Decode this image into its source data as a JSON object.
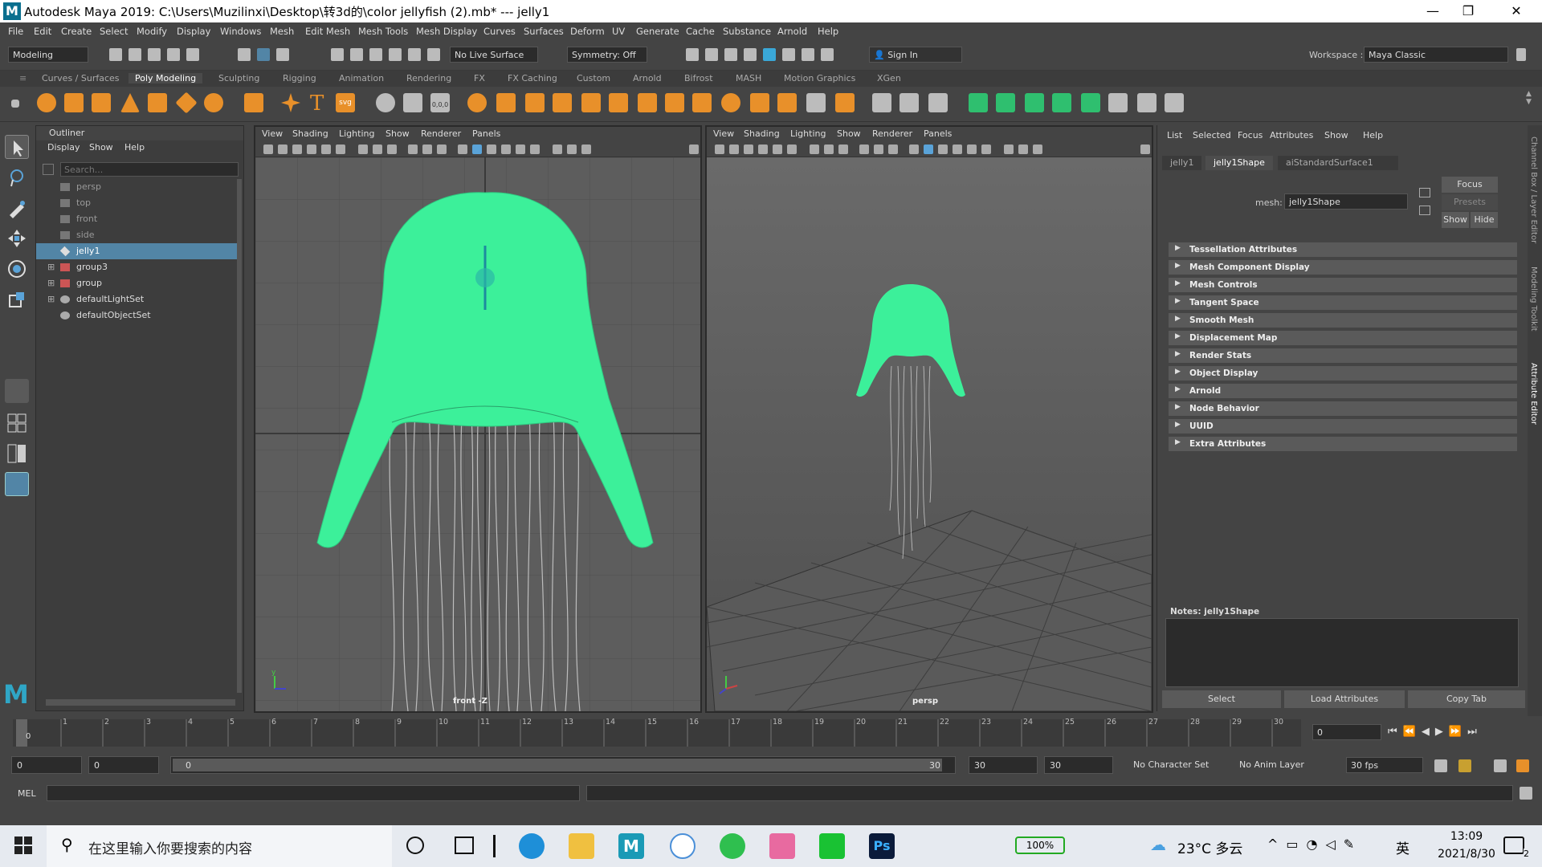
{
  "titlebar": {
    "title": "Autodesk Maya 2019: C:\\Users\\Muzilinxi\\Desktop\\转3d的\\color jellyfish (2).mb*   ---   jelly1",
    "logo": "M"
  },
  "menubar": [
    "File",
    "Edit",
    "Create",
    "Select",
    "Modify",
    "Display",
    "Windows",
    "Mesh",
    "Edit Mesh",
    "Mesh Tools",
    "Mesh Display",
    "Curves",
    "Surfaces",
    "Deform",
    "UV",
    "Generate",
    "Cache",
    "Substance",
    "Arnold",
    "Help"
  ],
  "statusline": {
    "mode": "Modeling",
    "live_surface": "No Live Surface",
    "symmetry": "Symmetry: Off",
    "sign_in": "Sign In",
    "workspace_label": "Workspace :",
    "workspace_value": "Maya Classic"
  },
  "shelf_tabs": [
    "Curves / Surfaces",
    "Poly Modeling",
    "Sculpting",
    "Rigging",
    "Animation",
    "Rendering",
    "FX",
    "FX Caching",
    "Custom",
    "Arnold",
    "Bifrost",
    "MASH",
    "Motion Graphics",
    "XGen"
  ],
  "shelf_active": "Poly Modeling",
  "shelf_svg_label": "svg",
  "shelf_num_label": "0,0,0",
  "outliner": {
    "title": "Outliner",
    "menu": [
      "Display",
      "Show",
      "Help"
    ],
    "search_placeholder": "Search...",
    "items": [
      {
        "label": "persp",
        "selected": false
      },
      {
        "label": "top",
        "selected": false
      },
      {
        "label": "front",
        "selected": false
      },
      {
        "label": "side",
        "selected": false
      },
      {
        "label": "jelly1",
        "selected": true
      },
      {
        "label": "group3",
        "selected": false
      },
      {
        "label": "group",
        "selected": false
      },
      {
        "label": "defaultLightSet",
        "selected": false
      },
      {
        "label": "defaultObjectSet",
        "selected": false
      }
    ]
  },
  "viewport_left": {
    "menu": [
      "View",
      "Shading",
      "Lighting",
      "Show",
      "Renderer",
      "Panels"
    ],
    "camera": "front -Z"
  },
  "viewport_right": {
    "menu": [
      "View",
      "Shading",
      "Lighting",
      "Show",
      "Renderer",
      "Panels"
    ],
    "camera": "persp"
  },
  "attribute_editor": {
    "menu": [
      "List",
      "Selected",
      "Focus",
      "Attributes",
      "Show",
      "Help"
    ],
    "tabs": [
      "jelly1",
      "jelly1Shape",
      "aiStandardSurface1"
    ],
    "active_tab": "jelly1Shape",
    "mesh_label": "mesh:",
    "mesh_value": "jelly1Shape",
    "focus_btn": "Focus",
    "presets_btn": "Presets",
    "show_btn": "Show",
    "hide_btn": "Hide",
    "sections": [
      "Tessellation Attributes",
      "Mesh Component Display",
      "Mesh Controls",
      "Tangent Space",
      "Smooth Mesh",
      "Displacement Map",
      "Render Stats",
      "Object Display",
      "Arnold",
      "Node Behavior",
      "UUID",
      "Extra Attributes"
    ],
    "notes_label": "Notes:  jelly1Shape",
    "bottom_buttons": [
      "Select",
      "Load Attributes",
      "Copy Tab"
    ]
  },
  "side_strip": [
    "Channel Box / Layer Editor",
    "Modeling Toolkit",
    "Attribute Editor"
  ],
  "time_slider": {
    "ticks": [
      "1",
      "2",
      "3",
      "4",
      "5",
      "6",
      "7",
      "8",
      "9",
      "10",
      "11",
      "12",
      "13",
      "14",
      "15",
      "16",
      "17",
      "18",
      "19",
      "20",
      "21",
      "22",
      "23",
      "24",
      "25",
      "26",
      "27",
      "28",
      "29",
      "30"
    ],
    "current_frame": "0",
    "frame_field": "0"
  },
  "range_slider": {
    "start": "0",
    "anim_start": "0",
    "range_start_label": "0",
    "range_end_label": "30",
    "anim_end": "30",
    "end": "30",
    "character_set": "No Character Set",
    "anim_layer": "No Anim Layer",
    "fps": "30 fps"
  },
  "cmdline": {
    "label": "MEL"
  },
  "taskbar": {
    "search_placeholder": "在这里输入你要搜索的内容",
    "battery": "100%",
    "weather": "23°C 多云",
    "ime": "英",
    "time": "13:09",
    "date": "2021/8/30",
    "notif_count": "2"
  },
  "colors": {
    "jelly": "#3cf09a",
    "selection": "#5285a6",
    "accent_orange": "#e8902a"
  }
}
